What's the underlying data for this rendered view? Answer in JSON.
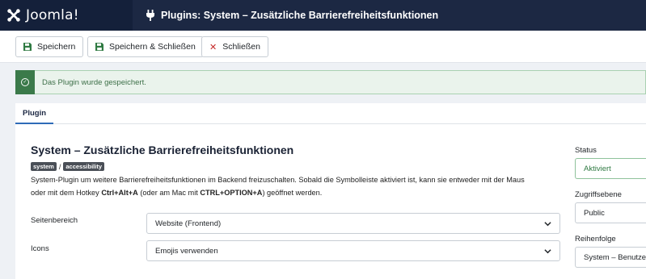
{
  "header": {
    "logo_text": "Joomla!",
    "page_title": "Plugins: System – Zusätzliche Barrierefreiheitsfunktionen"
  },
  "toolbar": {
    "save_label": "Speichern",
    "save_close_label": "Speichern & Schließen",
    "close_label": "Schließen"
  },
  "alert": {
    "message": "Das Plugin wurde gespeichert."
  },
  "tabs": {
    "plugin_label": "Plugin"
  },
  "plugin": {
    "title": "System – Zusätzliche Barrierefreiheitsfunktionen",
    "badges": [
      "system",
      "accessibility"
    ],
    "badge_separator": "/",
    "description_line1": "System-Plugin um weitere Barrierefreiheitsfunktionen im Backend freizuschalten. Sobald die Symbolleiste aktiviert ist, kann sie entweder mit der Maus",
    "description_part_a": "oder mit dem Hotkey ",
    "hotkey_1": "Ctrl+Alt+A",
    "description_part_b": " (oder am Mac mit ",
    "hotkey_2": "CTRL+OPTION+A",
    "description_part_c": ") geöffnet werden."
  },
  "fields": {
    "area": {
      "label": "Seitenbereich",
      "value": "Website (Frontend)"
    },
    "icons": {
      "label": "Icons",
      "value": "Emojis verwenden"
    }
  },
  "sidebar": {
    "status": {
      "label": "Status",
      "value": "Aktiviert"
    },
    "access": {
      "label": "Zugriffsebene",
      "value": "Public"
    },
    "ordering": {
      "label": "Reihenfolge",
      "value": "System – Benutzer"
    }
  },
  "colors": {
    "header_bg": "#1c2843",
    "alert_green": "#3b7a4a",
    "close_red": "#c52827",
    "tab_accent": "#2e6bb8"
  }
}
